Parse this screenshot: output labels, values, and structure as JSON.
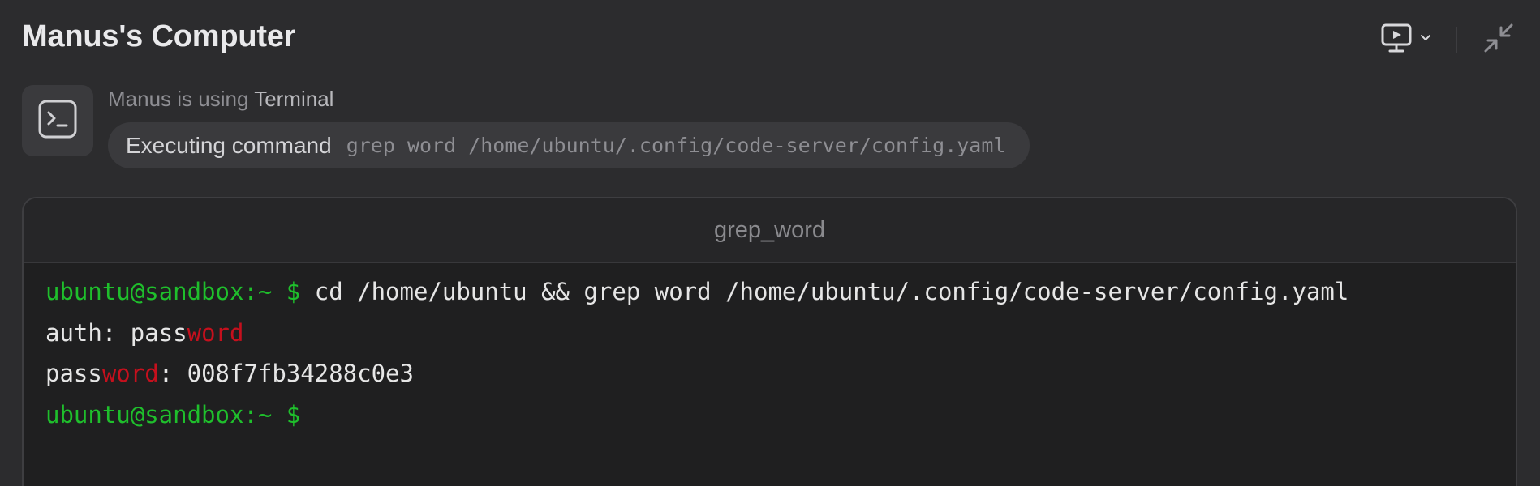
{
  "window": {
    "title": "Manus's Computer"
  },
  "toolbar": {
    "view_icon": "monitor-play-icon",
    "dropdown_icon": "chevron-down-icon",
    "minimize_icon": "collapse-arrows-icon"
  },
  "status": {
    "icon": "terminal-icon",
    "using_prefix": "Manus is using",
    "tool_name": "Terminal",
    "action_label": "Executing command",
    "command": "grep word /home/ubuntu/.config/code-server/config.yaml"
  },
  "terminal": {
    "tab_title": "grep_word",
    "lines": {
      "l1_prompt": "ubuntu@sandbox:~ $",
      "l1_command": " cd /home/ubuntu && grep word /home/ubuntu/.config/code-server/config.yaml",
      "l2_pre": "auth: pass",
      "l2_match": "word",
      "l3_pre": "pass",
      "l3_match": "word",
      "l3_post": ": 008f7fb34288c0e3",
      "l4_prompt": "ubuntu@sandbox:~ $"
    }
  },
  "colors": {
    "background": "#2c2c2e",
    "terminal_bg": "#1f1f20",
    "prompt_green": "#1fbf2c",
    "match_red": "#c5101d"
  }
}
